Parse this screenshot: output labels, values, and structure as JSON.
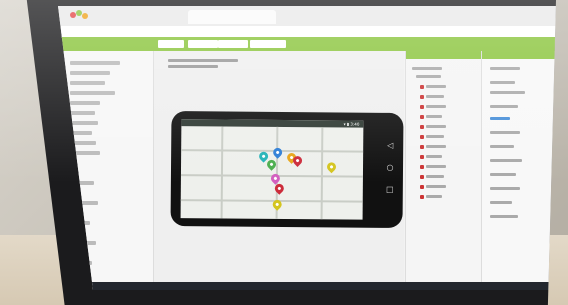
{
  "phone": {
    "status_time": "3:40"
  },
  "icons": [
    "browser-tab-icon",
    "map-marker-icon",
    "back-nav-icon",
    "home-nav-icon",
    "recent-apps-icon",
    "wifi-icon",
    "battery-icon"
  ],
  "colors": {
    "green_bar": "#8cc63f",
    "pin_colors": [
      "#2f7fd6",
      "#26b4b8",
      "#4cae4f",
      "#e8a61a",
      "#cc2c3b",
      "#d35fbf",
      "#d4c51f"
    ]
  }
}
